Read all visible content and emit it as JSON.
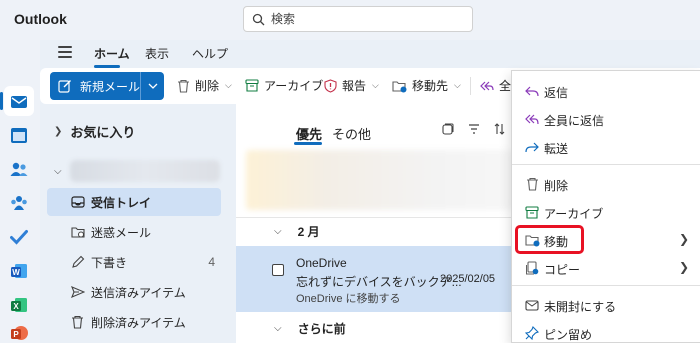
{
  "app": {
    "title": "Outlook"
  },
  "search": {
    "placeholder": "検索"
  },
  "ribbon_tabs": [
    "ホーム",
    "表示",
    "ヘルプ"
  ],
  "toolbar": {
    "new_mail": "新規メール",
    "delete": "削除",
    "archive": "アーカイブ",
    "report": "報告",
    "move": "移動先",
    "reply_all_partial": "全"
  },
  "folders": {
    "favorites": "お気に入り",
    "items": [
      {
        "label": "受信トレイ",
        "count": ""
      },
      {
        "label": "迷惑メール",
        "count": ""
      },
      {
        "label": "下書き",
        "count": "4"
      },
      {
        "label": "送信済みアイテム",
        "count": ""
      },
      {
        "label": "削除済みアイテム",
        "count": ""
      }
    ]
  },
  "message_list": {
    "tab_focused": "優先",
    "tab_other": "その他",
    "group_feb": "2 月",
    "group_older": "さらに前",
    "message": {
      "from": "OneDrive",
      "subject": "忘れずにデバイスをバックア...",
      "date": "2025/02/05",
      "preview": "OneDrive に移動する"
    }
  },
  "context_menu": {
    "reply": "返信",
    "reply_all": "全員に返信",
    "forward": "転送",
    "delete": "削除",
    "archive": "アーカイブ",
    "move": "移動",
    "copy": "コピー",
    "mark_unread": "未開封にする",
    "pin": "ピン留め"
  },
  "colors": {
    "accent": "#0f6cbd",
    "highlight": "#e81123"
  }
}
